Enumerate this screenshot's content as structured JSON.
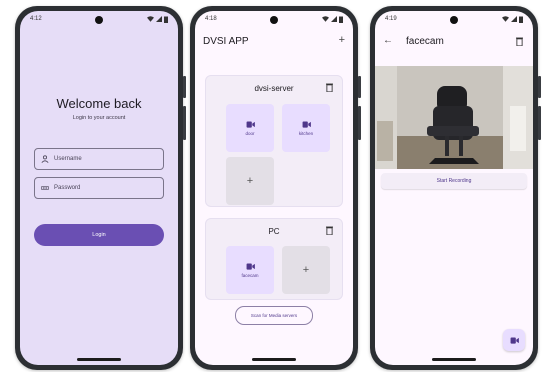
{
  "status_times": [
    "4:12",
    "4:18",
    "4:19"
  ],
  "login": {
    "title": "Welcome back",
    "subtitle": "Login to your account",
    "username_placeholder": "Username",
    "password_placeholder": "Password",
    "login_label": "Login"
  },
  "home": {
    "title": "DVSI APP",
    "servers": [
      {
        "name": "dvsi-server",
        "cameras": [
          "door",
          "kitchen"
        ]
      },
      {
        "name": "PC",
        "cameras": [
          "facecam"
        ]
      }
    ],
    "scan_label": "Scan for Media servers"
  },
  "camera": {
    "title": "facecam",
    "record_label": "Start Recording"
  },
  "colors": {
    "primary": "#6a4fb3",
    "login_bg": "#e6ddf7",
    "tile_bg": "#e8ddff"
  }
}
